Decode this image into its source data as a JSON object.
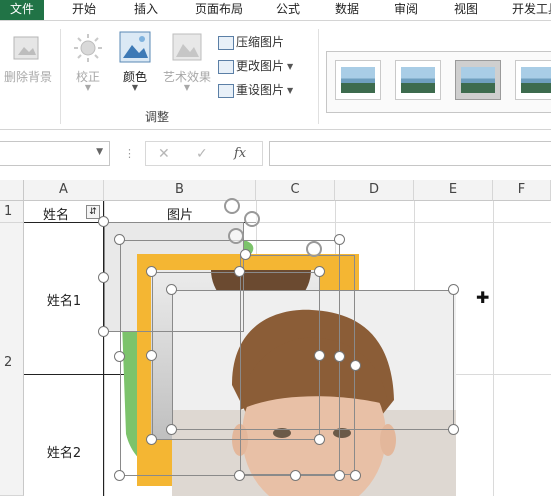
{
  "tabs": [
    "文件",
    "开始",
    "插入",
    "页面布局",
    "公式",
    "数据",
    "审阅",
    "视图",
    "开发工具"
  ],
  "ribbon": {
    "remove_bg": "删除背景",
    "correct": "校正",
    "color": "颜色",
    "artistic": "艺术效果",
    "compress": "压缩图片",
    "change": "更改图片",
    "reset": "重设图片",
    "group_label": "调整"
  },
  "formula_bar": {
    "cancel": "✕",
    "enter": "✓",
    "fx": "fx",
    "separator": "⋮"
  },
  "columns": [
    "A",
    "B",
    "C",
    "D",
    "E",
    "F"
  ],
  "rows": [
    "1",
    "2"
  ],
  "cells": {
    "a1": "姓名",
    "b1": "图片",
    "a2": "姓名1",
    "a3": "姓名2"
  },
  "colors": {
    "file_tab": "#217346",
    "frame_yellow": "#f4b633",
    "frame_green": "#7cc36b"
  }
}
